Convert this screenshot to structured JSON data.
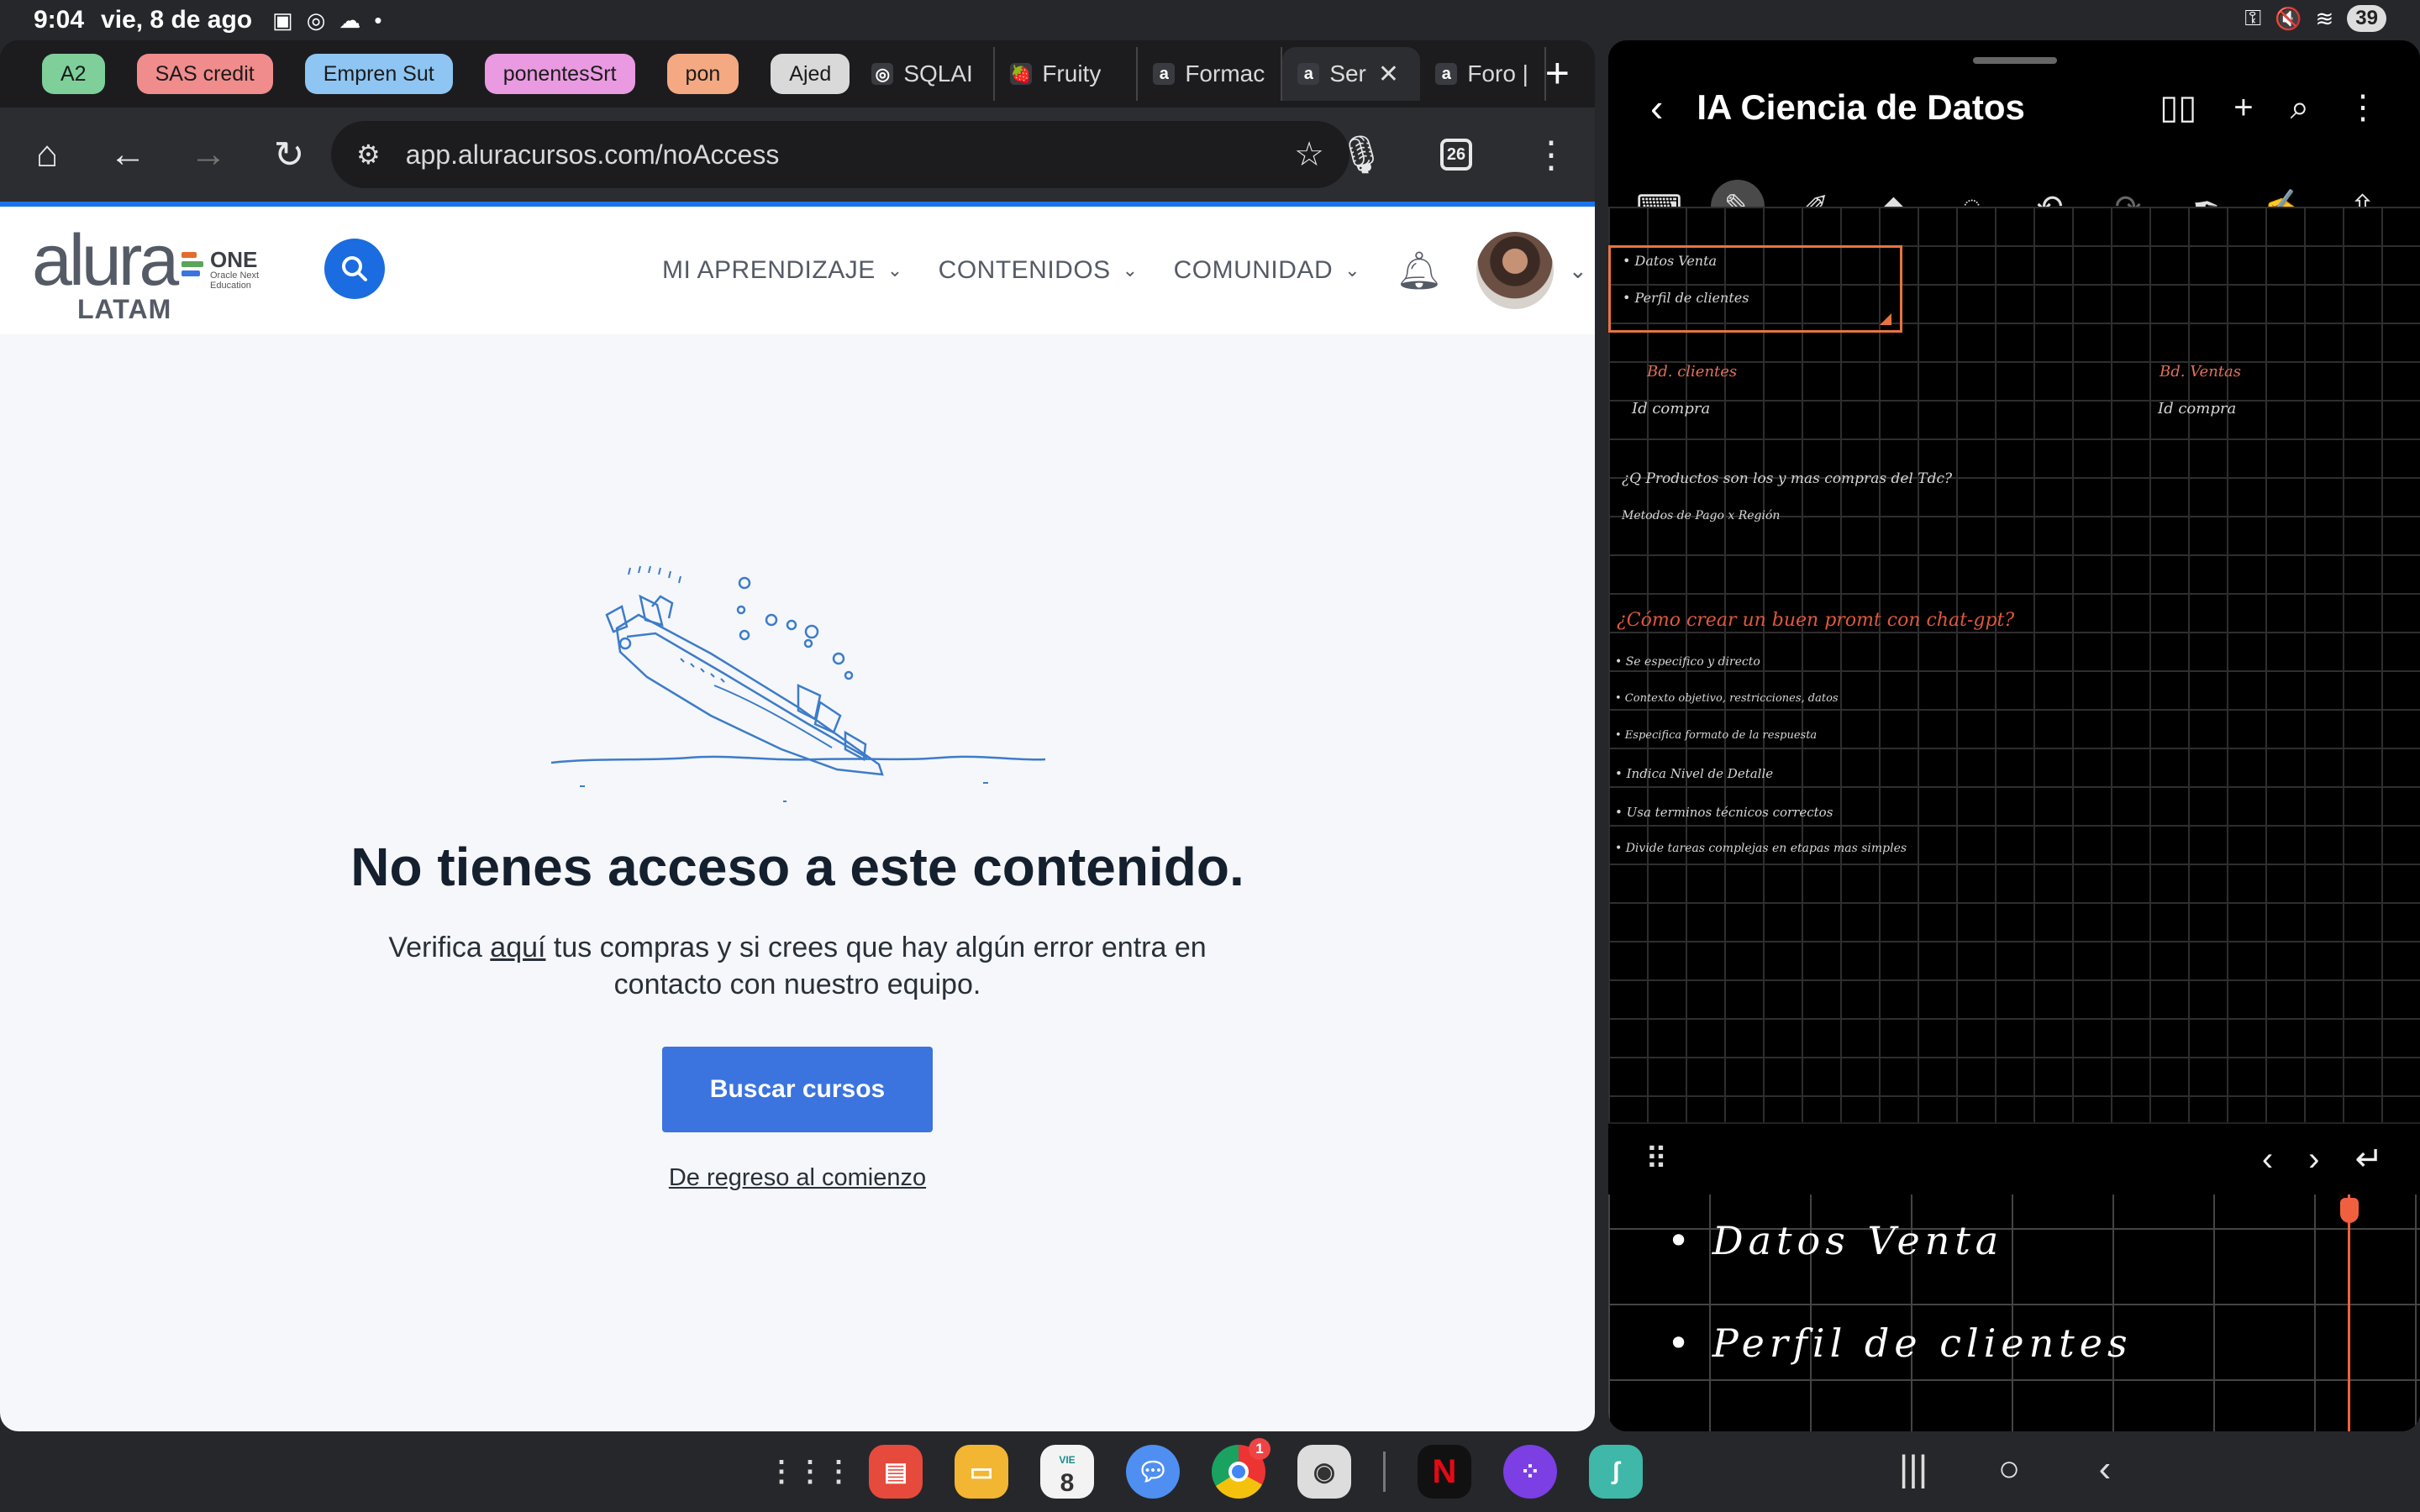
{
  "status_bar": {
    "time": "9:04",
    "date": "vie, 8 de ago",
    "battery": "39"
  },
  "browser": {
    "tab_chips": [
      {
        "label": "A2",
        "color": "#7ecf9a"
      },
      {
        "label": "SAS credit",
        "color": "#f08c8c"
      },
      {
        "label": "Empren Sut",
        "color": "#8ec5f2"
      },
      {
        "label": "ponentesSrt",
        "color": "#e99ae0"
      },
      {
        "label": "pon",
        "color": "#f4a982"
      },
      {
        "label": "Ajed",
        "color": "#d9d9d9"
      }
    ],
    "tabs": [
      {
        "label": "SQLAI",
        "fav": "◎"
      },
      {
        "label": "Fruity",
        "fav": "🍓"
      },
      {
        "label": "Formación",
        "fav": "a"
      },
      {
        "label": "Ser",
        "fav": "a",
        "active": true
      },
      {
        "label": "Foro |",
        "fav": "a"
      }
    ],
    "url": "app.aluracursos.com/noAccess",
    "tab_count": "26"
  },
  "site": {
    "logo_text": "alura",
    "logo_sub": "LATAM",
    "one_title": "ONE",
    "one_line1": "Oracle Next",
    "one_line2": "Education",
    "nav": [
      "MI APRENDIZAJE",
      "CONTENIDOS",
      "COMUNIDAD"
    ],
    "headline": "No tienes acceso a este contenido.",
    "desc_pre": "Verifica ",
    "desc_link": "aquí",
    "desc_post": " tus compras y si crees que hay algún error entra en",
    "desc_line2": "contacto con nuestro equipo.",
    "cta": "Buscar cursos",
    "back": "De regreso al comienzo"
  },
  "notes": {
    "title": "IA Ciencia de Datos",
    "selected_lines": [
      "• Datos  Venta",
      "• Perfil  de  clientes"
    ],
    "bd_clientes": "Bd. clientes",
    "id_compra_1": "Id  compra",
    "bd_ventas": "Bd. Ventas",
    "id_compra_2": "Id  compra",
    "question1": "¿Q  Productos  son los  y  mas compras del  Tdc?",
    "question2": "Metodos  de  Pago   x   Región",
    "prompt_title": "¿Cómo   crear   un   buen  promt  con  chat-gpt?",
    "bullets": [
      "• Se  especifico  y  directo",
      "• Contexto  objetivo, restricciones,  datos",
      "• Especifica  formato  de  la  respuesta",
      "• Indica  Nivel  de  Detalle",
      "• Usa  terminos  técnicos  correctos",
      "• Divide  tareas  complejas  en  etapas  mas simples"
    ],
    "pad_line1": "• Datos  Venta",
    "pad_line2": "• Perfil  de  clientes"
  },
  "taskbar": {
    "calendar_day": "8",
    "calendar_weekday": "VIE",
    "chrome_badge": "1"
  }
}
